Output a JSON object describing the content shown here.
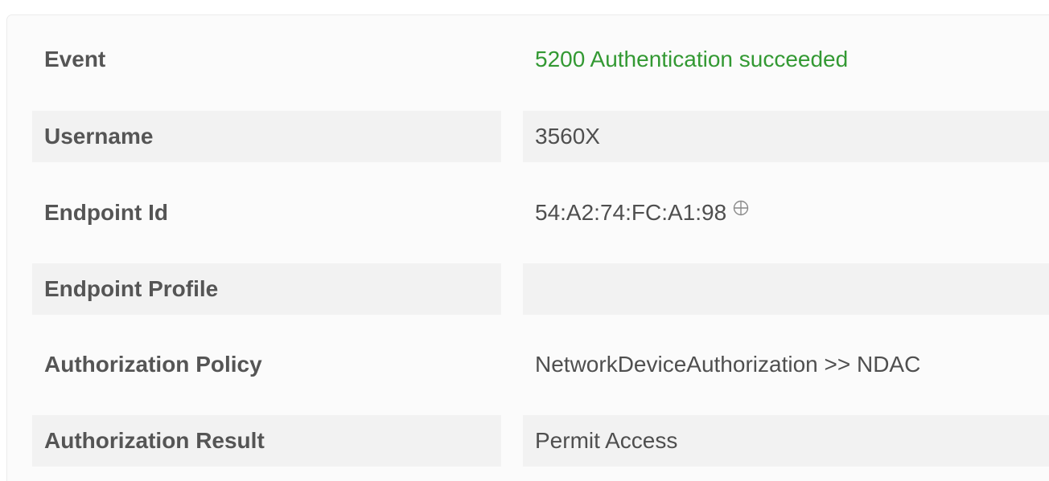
{
  "details": {
    "rows": [
      {
        "label": "Event",
        "value": "5200 Authentication succeeded",
        "status_color": "#339933"
      },
      {
        "label": "Username",
        "value": "3560X"
      },
      {
        "label": "Endpoint Id",
        "value": "54:A2:74:FC:A1:98",
        "icon": "crosshair-icon"
      },
      {
        "label": "Endpoint Profile",
        "value": ""
      },
      {
        "label": "Authorization Policy",
        "value": "NetworkDeviceAuthorization >> NDAC"
      },
      {
        "label": "Authorization Result",
        "value": "Permit Access"
      }
    ]
  }
}
